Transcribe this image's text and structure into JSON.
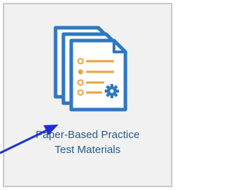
{
  "tile": {
    "label_line1": "Paper-Based Practice",
    "label_line2": "Test Materials",
    "icon": "document-stack-settings-icon",
    "colors": {
      "background": "#f1f1f1",
      "border": "#c9c9c9",
      "label": "#2a5b86",
      "icon_blue": "#2f78bf",
      "icon_orange": "#e9a23b"
    }
  },
  "overlay": {
    "pointer": "annotation-arrow",
    "color": "#1f2fd6"
  }
}
